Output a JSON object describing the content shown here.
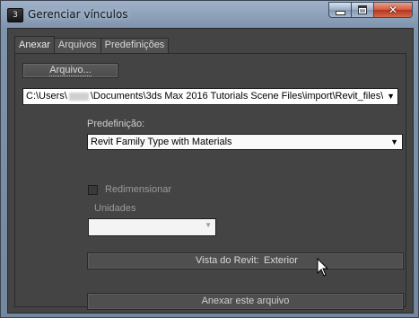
{
  "window": {
    "title": "Gerenciar vínculos",
    "icon_letter": "3",
    "controls": {
      "minimize": "minimize-icon",
      "maximize": "maximize-icon",
      "close": "close-icon"
    }
  },
  "tabs": [
    {
      "label": "Anexar",
      "active": true
    },
    {
      "label": "Arquivos",
      "active": false
    },
    {
      "label": "Predefinições",
      "active": false
    }
  ],
  "attach": {
    "file_button": "Arquivo...",
    "path_prefix": "C:\\Users\\",
    "path_suffix": "\\Documents\\3ds Max 2016 Tutorials Scene Files\\import\\Revit_files\\",
    "preset_label": "Predefinição:",
    "preset_value": "Revit Family Type with Materials",
    "resize_label": "Redimensionar",
    "units_label": "Unidades",
    "units_value": "",
    "revit_view_label": "Vista do Revit:",
    "revit_view_value": "Exterior",
    "attach_button": "Anexar este arquivo"
  },
  "colors": {
    "client_bg": "#444444",
    "frame_bg": "#7f94ad",
    "close_button": "#c94a2f"
  }
}
